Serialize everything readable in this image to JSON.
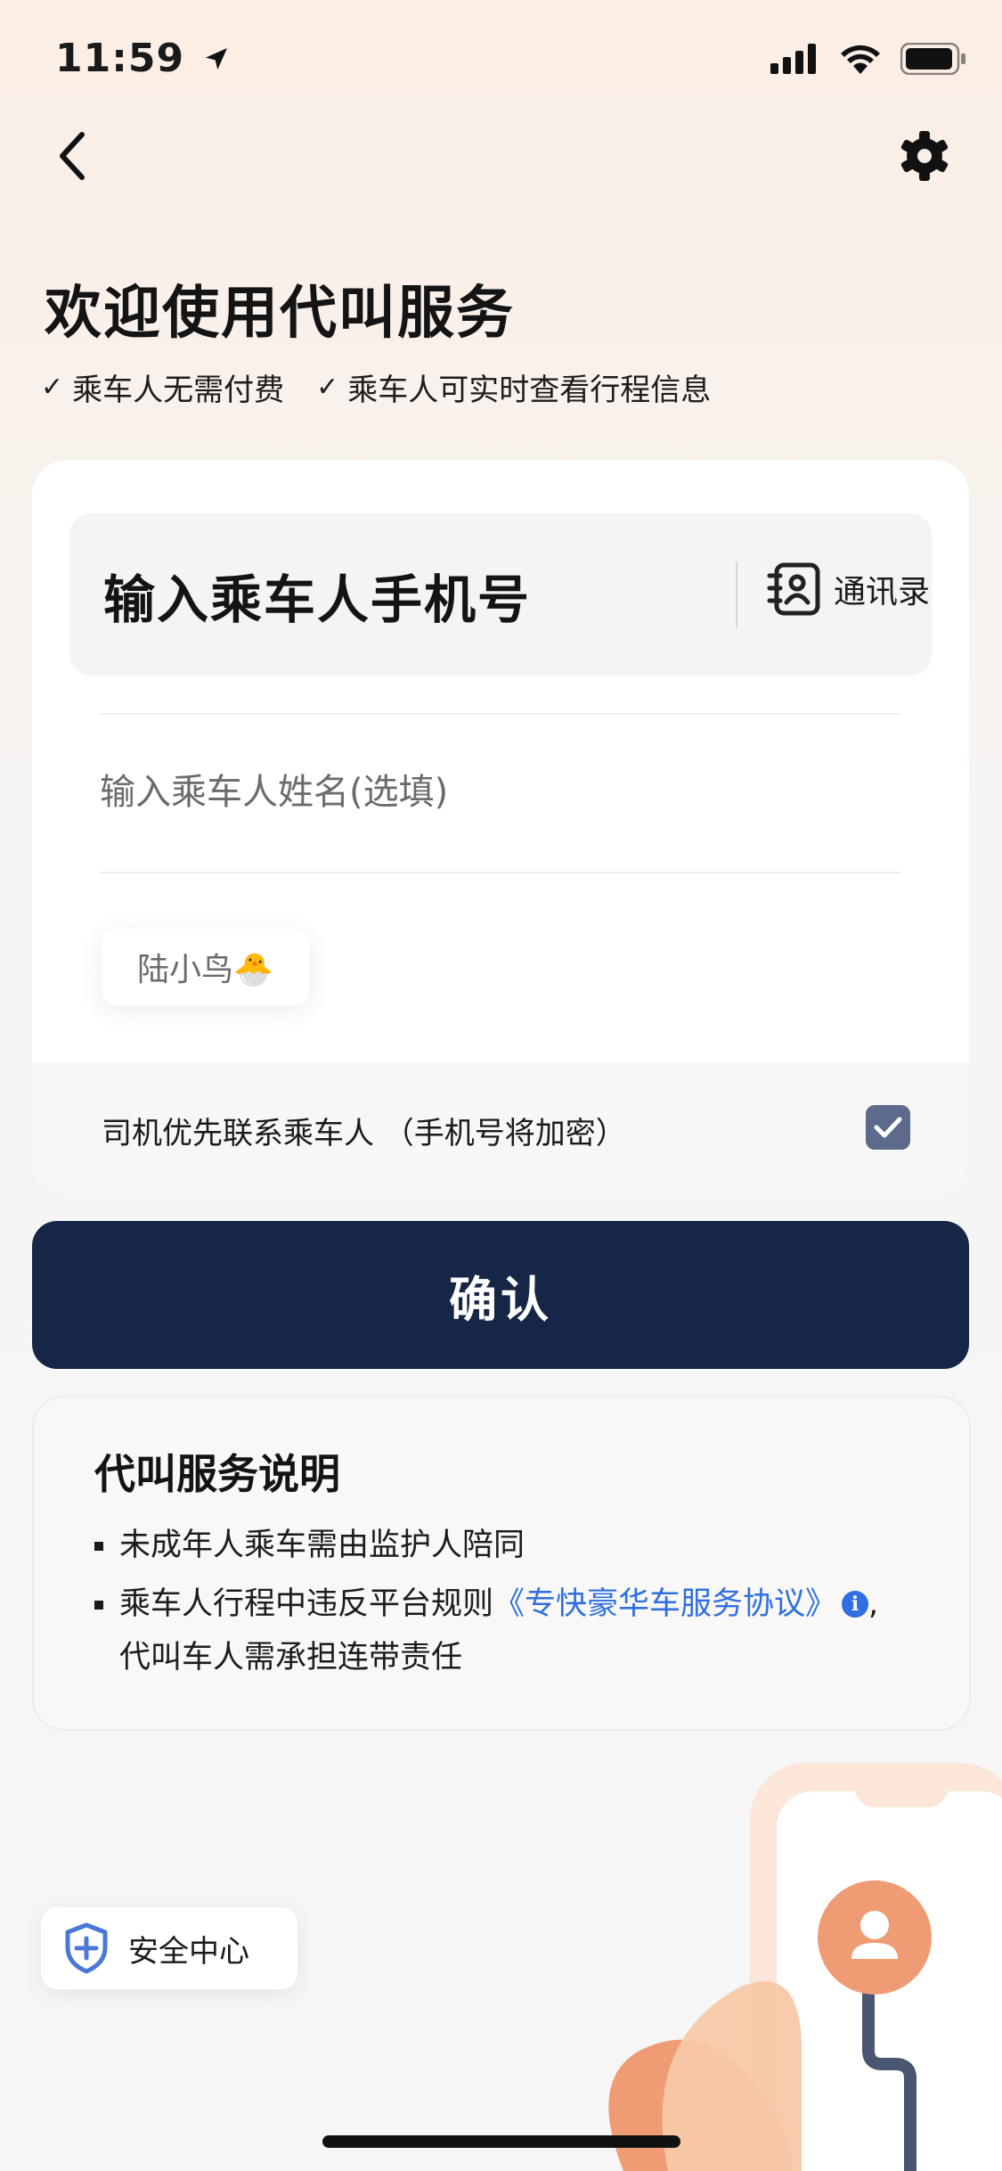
{
  "status_bar": {
    "time": "11:59"
  },
  "header": {
    "title": "欢迎使用代叫服务"
  },
  "features": [
    {
      "check": "✓",
      "text": "乘车人无需付费"
    },
    {
      "check": "✓",
      "text": "乘车人可实时查看行程信息"
    }
  ],
  "form": {
    "phone_placeholder": "输入乘车人手机号",
    "contacts_label": "通讯录",
    "name_placeholder": "输入乘车人姓名(选填)",
    "name_chip": "陆小鸟🐣",
    "priority_label": "司机优先联系乘车人 （手机号将加密）",
    "priority_checked": true
  },
  "confirm_label": "确认",
  "info": {
    "title": "代叫服务说明",
    "item1": "未成年人乘车需由监护人陪同",
    "item2_prefix": "乘车人行程中违反平台规则",
    "item2_link": "《专快豪华车服务协议》",
    "item2_suffix": ",",
    "item2_line2": "代叫车人需承担连带责任",
    "info_badge": "i"
  },
  "safety": {
    "label": "安全中心"
  },
  "colors": {
    "primary_button": "#152646",
    "link": "#2f6fe0",
    "checkbox": "#5e6a8c",
    "accent_orange": "#ef9b74"
  },
  "icons": [
    "location-arrow-icon",
    "signal-icon",
    "wifi-icon",
    "battery-icon",
    "back-arrow-icon",
    "gear-icon",
    "contacts-book-icon",
    "checkbox-checked-icon",
    "info-icon",
    "shield-plus-icon"
  ]
}
